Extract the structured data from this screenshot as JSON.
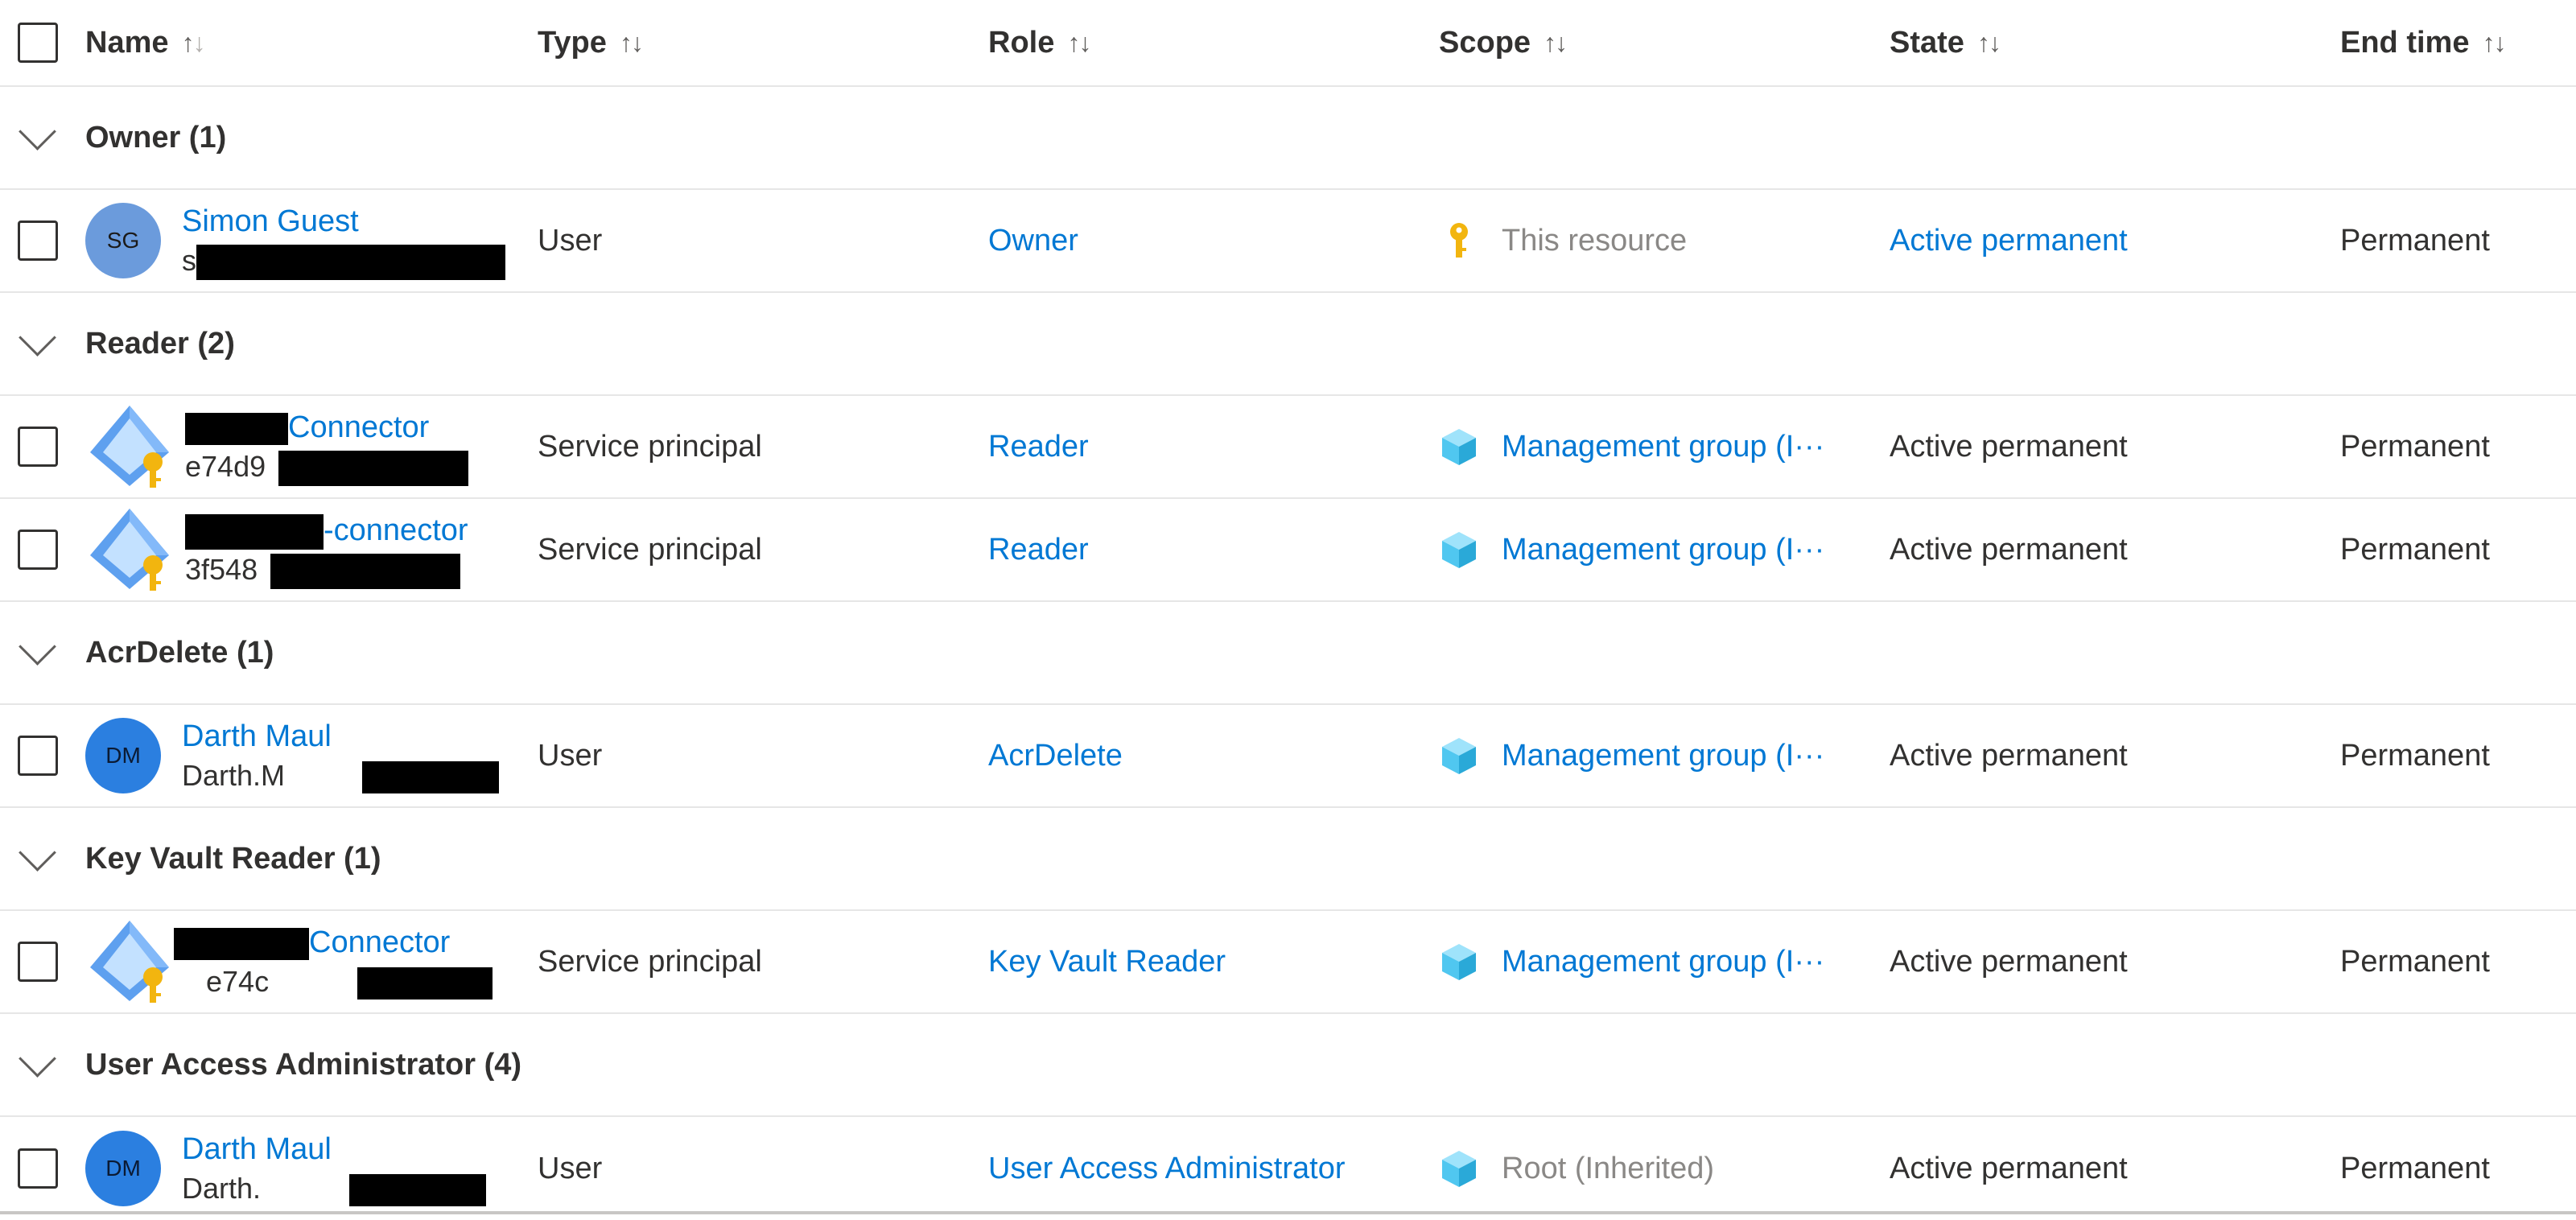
{
  "columns": {
    "name": "Name",
    "type": "Type",
    "role": "Role",
    "scope": "Scope",
    "state": "State",
    "end_time": "End time"
  },
  "groups": [
    {
      "label": "Owner (1)",
      "rows": [
        {
          "avatar": "SG",
          "name": "Simon Guest",
          "sub": "s",
          "type": "User",
          "role": "Owner",
          "scope": "This resource",
          "scope_icon": "key-icon",
          "state": "Active permanent",
          "end_time": "Permanent"
        }
      ]
    },
    {
      "label": "Reader (2)",
      "rows": [
        {
          "name_suffix": "Connector",
          "sub": "e74d9",
          "type": "Service principal",
          "role": "Reader",
          "scope": "Management group (I···",
          "scope_icon": "management-group-icon",
          "state": "Active permanent",
          "end_time": "Permanent"
        },
        {
          "name_suffix": "-connector",
          "sub": "3f548",
          "type": "Service principal",
          "role": "Reader",
          "scope": "Management group (I···",
          "scope_icon": "management-group-icon",
          "state": "Active permanent",
          "end_time": "Permanent"
        }
      ]
    },
    {
      "label": "AcrDelete (1)",
      "rows": [
        {
          "avatar": "DM",
          "name": "Darth Maul",
          "sub": "Darth.M",
          "type": "User",
          "role": "AcrDelete",
          "scope": "Management group (I···",
          "scope_icon": "management-group-icon",
          "state": "Active permanent",
          "end_time": "Permanent"
        }
      ]
    },
    {
      "label": "Key Vault Reader (1)",
      "rows": [
        {
          "name_suffix": "Connector",
          "sub": "e74c",
          "type": "Service principal",
          "role": "Key Vault Reader",
          "scope": "Management group (I···",
          "scope_icon": "management-group-icon",
          "state": "Active permanent",
          "end_time": "Permanent"
        }
      ]
    },
    {
      "label": "User Access Administrator (4)",
      "rows": [
        {
          "avatar": "DM",
          "name": "Darth Maul",
          "sub": "Darth.",
          "type": "User",
          "role": "User Access Administrator",
          "scope": "Root (Inherited)",
          "scope_icon": "management-group-icon",
          "state": "Active permanent",
          "end_time": "Permanent"
        }
      ]
    }
  ],
  "colors": {
    "link": "#0078d4",
    "text": "#323130",
    "muted": "#8a8886",
    "key": "#f2b50f",
    "cube": "#50c7f0"
  }
}
